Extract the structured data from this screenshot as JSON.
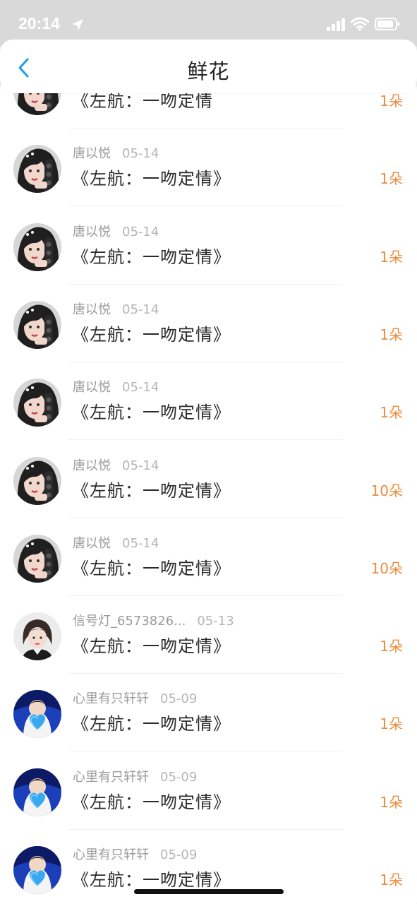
{
  "status": {
    "time": "20:14"
  },
  "nav": {
    "title": "鲜花"
  },
  "records": [
    {
      "user": "",
      "date": "",
      "title": "《左航：一吻定情",
      "count": "1朵",
      "avatar": "girl-braid"
    },
    {
      "user": "唐以悦",
      "date": "05-14",
      "title": "《左航：一吻定情》",
      "count": "1朵",
      "avatar": "girl-braid"
    },
    {
      "user": "唐以悦",
      "date": "05-14",
      "title": "《左航：一吻定情》",
      "count": "1朵",
      "avatar": "girl-braid"
    },
    {
      "user": "唐以悦",
      "date": "05-14",
      "title": "《左航：一吻定情》",
      "count": "1朵",
      "avatar": "girl-braid"
    },
    {
      "user": "唐以悦",
      "date": "05-14",
      "title": "《左航：一吻定情》",
      "count": "1朵",
      "avatar": "girl-braid"
    },
    {
      "user": "唐以悦",
      "date": "05-14",
      "title": "《左航：一吻定情》",
      "count": "10朵",
      "avatar": "girl-braid"
    },
    {
      "user": "唐以悦",
      "date": "05-14",
      "title": "《左航：一吻定情》",
      "count": "10朵",
      "avatar": "girl-braid"
    },
    {
      "user": "信号灯_6573826...",
      "date": "05-13",
      "title": "《左航：一吻定情》",
      "count": "1朵",
      "avatar": "girl-short-hair"
    },
    {
      "user": "心里有只轩轩",
      "date": "05-09",
      "title": "《左航：一吻定情》",
      "count": "1朵",
      "avatar": "boy-blue-heart"
    },
    {
      "user": "心里有只轩轩",
      "date": "05-09",
      "title": "《左航：一吻定情》",
      "count": "1朵",
      "avatar": "boy-blue-heart"
    },
    {
      "user": "心里有只轩轩",
      "date": "05-09",
      "title": "《左航：一吻定情》",
      "count": "1朵",
      "avatar": "boy-blue-heart"
    }
  ],
  "colors": {
    "accent": "#ee8a3c",
    "back": "#1f9de9"
  }
}
